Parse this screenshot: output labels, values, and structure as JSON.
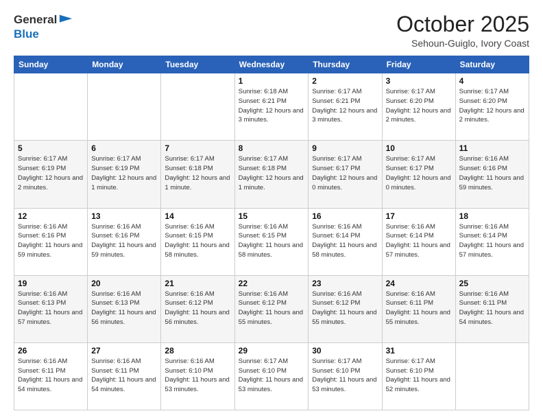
{
  "header": {
    "logo_line1": "General",
    "logo_line2": "Blue",
    "month_title": "October 2025",
    "location": "Sehoun-Guiglo, Ivory Coast"
  },
  "days_of_week": [
    "Sunday",
    "Monday",
    "Tuesday",
    "Wednesday",
    "Thursday",
    "Friday",
    "Saturday"
  ],
  "weeks": [
    [
      {
        "day": "",
        "info": ""
      },
      {
        "day": "",
        "info": ""
      },
      {
        "day": "",
        "info": ""
      },
      {
        "day": "1",
        "info": "Sunrise: 6:18 AM\nSunset: 6:21 PM\nDaylight: 12 hours and 3 minutes."
      },
      {
        "day": "2",
        "info": "Sunrise: 6:17 AM\nSunset: 6:21 PM\nDaylight: 12 hours and 3 minutes."
      },
      {
        "day": "3",
        "info": "Sunrise: 6:17 AM\nSunset: 6:20 PM\nDaylight: 12 hours and 2 minutes."
      },
      {
        "day": "4",
        "info": "Sunrise: 6:17 AM\nSunset: 6:20 PM\nDaylight: 12 hours and 2 minutes."
      }
    ],
    [
      {
        "day": "5",
        "info": "Sunrise: 6:17 AM\nSunset: 6:19 PM\nDaylight: 12 hours and 2 minutes."
      },
      {
        "day": "6",
        "info": "Sunrise: 6:17 AM\nSunset: 6:19 PM\nDaylight: 12 hours and 1 minute."
      },
      {
        "day": "7",
        "info": "Sunrise: 6:17 AM\nSunset: 6:18 PM\nDaylight: 12 hours and 1 minute."
      },
      {
        "day": "8",
        "info": "Sunrise: 6:17 AM\nSunset: 6:18 PM\nDaylight: 12 hours and 1 minute."
      },
      {
        "day": "9",
        "info": "Sunrise: 6:17 AM\nSunset: 6:17 PM\nDaylight: 12 hours and 0 minutes."
      },
      {
        "day": "10",
        "info": "Sunrise: 6:17 AM\nSunset: 6:17 PM\nDaylight: 12 hours and 0 minutes."
      },
      {
        "day": "11",
        "info": "Sunrise: 6:16 AM\nSunset: 6:16 PM\nDaylight: 11 hours and 59 minutes."
      }
    ],
    [
      {
        "day": "12",
        "info": "Sunrise: 6:16 AM\nSunset: 6:16 PM\nDaylight: 11 hours and 59 minutes."
      },
      {
        "day": "13",
        "info": "Sunrise: 6:16 AM\nSunset: 6:16 PM\nDaylight: 11 hours and 59 minutes."
      },
      {
        "day": "14",
        "info": "Sunrise: 6:16 AM\nSunset: 6:15 PM\nDaylight: 11 hours and 58 minutes."
      },
      {
        "day": "15",
        "info": "Sunrise: 6:16 AM\nSunset: 6:15 PM\nDaylight: 11 hours and 58 minutes."
      },
      {
        "day": "16",
        "info": "Sunrise: 6:16 AM\nSunset: 6:14 PM\nDaylight: 11 hours and 58 minutes."
      },
      {
        "day": "17",
        "info": "Sunrise: 6:16 AM\nSunset: 6:14 PM\nDaylight: 11 hours and 57 minutes."
      },
      {
        "day": "18",
        "info": "Sunrise: 6:16 AM\nSunset: 6:14 PM\nDaylight: 11 hours and 57 minutes."
      }
    ],
    [
      {
        "day": "19",
        "info": "Sunrise: 6:16 AM\nSunset: 6:13 PM\nDaylight: 11 hours and 57 minutes."
      },
      {
        "day": "20",
        "info": "Sunrise: 6:16 AM\nSunset: 6:13 PM\nDaylight: 11 hours and 56 minutes."
      },
      {
        "day": "21",
        "info": "Sunrise: 6:16 AM\nSunset: 6:12 PM\nDaylight: 11 hours and 56 minutes."
      },
      {
        "day": "22",
        "info": "Sunrise: 6:16 AM\nSunset: 6:12 PM\nDaylight: 11 hours and 55 minutes."
      },
      {
        "day": "23",
        "info": "Sunrise: 6:16 AM\nSunset: 6:12 PM\nDaylight: 11 hours and 55 minutes."
      },
      {
        "day": "24",
        "info": "Sunrise: 6:16 AM\nSunset: 6:11 PM\nDaylight: 11 hours and 55 minutes."
      },
      {
        "day": "25",
        "info": "Sunrise: 6:16 AM\nSunset: 6:11 PM\nDaylight: 11 hours and 54 minutes."
      }
    ],
    [
      {
        "day": "26",
        "info": "Sunrise: 6:16 AM\nSunset: 6:11 PM\nDaylight: 11 hours and 54 minutes."
      },
      {
        "day": "27",
        "info": "Sunrise: 6:16 AM\nSunset: 6:11 PM\nDaylight: 11 hours and 54 minutes."
      },
      {
        "day": "28",
        "info": "Sunrise: 6:16 AM\nSunset: 6:10 PM\nDaylight: 11 hours and 53 minutes."
      },
      {
        "day": "29",
        "info": "Sunrise: 6:17 AM\nSunset: 6:10 PM\nDaylight: 11 hours and 53 minutes."
      },
      {
        "day": "30",
        "info": "Sunrise: 6:17 AM\nSunset: 6:10 PM\nDaylight: 11 hours and 53 minutes."
      },
      {
        "day": "31",
        "info": "Sunrise: 6:17 AM\nSunset: 6:10 PM\nDaylight: 11 hours and 52 minutes."
      },
      {
        "day": "",
        "info": ""
      }
    ]
  ]
}
